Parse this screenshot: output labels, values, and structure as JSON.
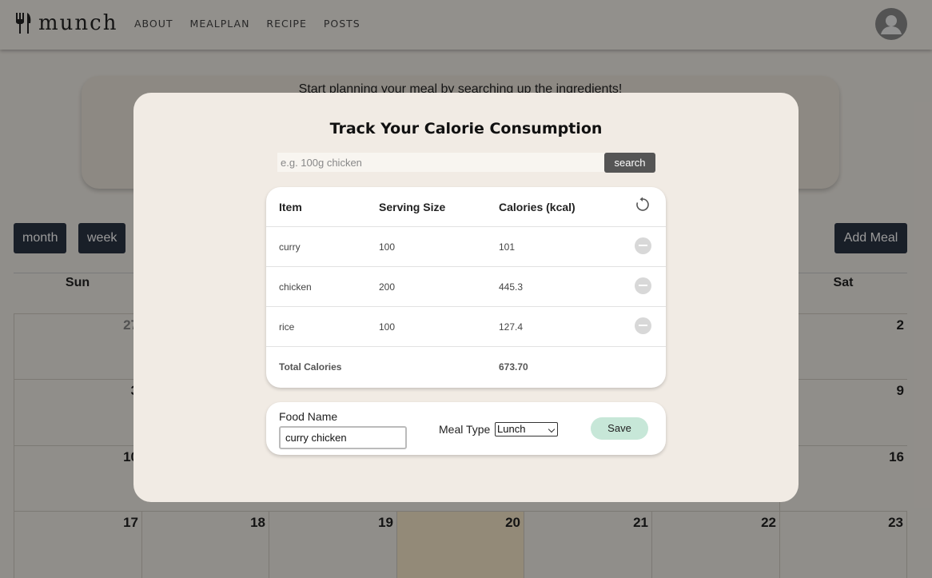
{
  "nav": {
    "logo_text": "munch",
    "links": [
      "ABOUT",
      "MEALPLAN",
      "RECIPE",
      "POSTS"
    ]
  },
  "background": {
    "search_card_text": "Start planning your meal by searching up the ingredients!",
    "view_buttons": [
      "month",
      "week"
    ],
    "add_meal_label": "Add Meal",
    "calendar": {
      "day_headers": [
        "Sun",
        "Sat"
      ],
      "rows": [
        [
          "27",
          "",
          "",
          "",
          "",
          "",
          "2"
        ],
        [
          "3",
          "",
          "",
          "",
          "",
          "",
          "9"
        ],
        [
          "10",
          "",
          "",
          "",
          "",
          "",
          "16"
        ],
        [
          "17",
          "18",
          "19",
          "20",
          "21",
          "22",
          "23"
        ]
      ]
    }
  },
  "modal": {
    "title": "Track Your Calorie Consumption",
    "search": {
      "placeholder": "e.g. 100g chicken",
      "button_label": "search"
    },
    "table": {
      "headers": {
        "item": "Item",
        "serving": "Serving Size",
        "calories": "Calories (kcal)"
      },
      "rows": [
        {
          "item": "curry",
          "serving": "100",
          "calories": "101"
        },
        {
          "item": "chicken",
          "serving": "200",
          "calories": "445.3"
        },
        {
          "item": "rice",
          "serving": "100",
          "calories": "127.4"
        }
      ],
      "total_label": "Total Calories",
      "total_value": "673.70"
    },
    "form": {
      "food_name_label": "Food Name",
      "food_name_value": "curry chicken",
      "meal_type_label": "Meal Type",
      "meal_type_value": "Lunch",
      "save_label": "Save"
    }
  },
  "colors": {
    "page_bg": "#f1ede6",
    "dark_button": "#2b3444",
    "save_button": "#c7e7d8",
    "today_highlight": "#f5e7c9"
  }
}
